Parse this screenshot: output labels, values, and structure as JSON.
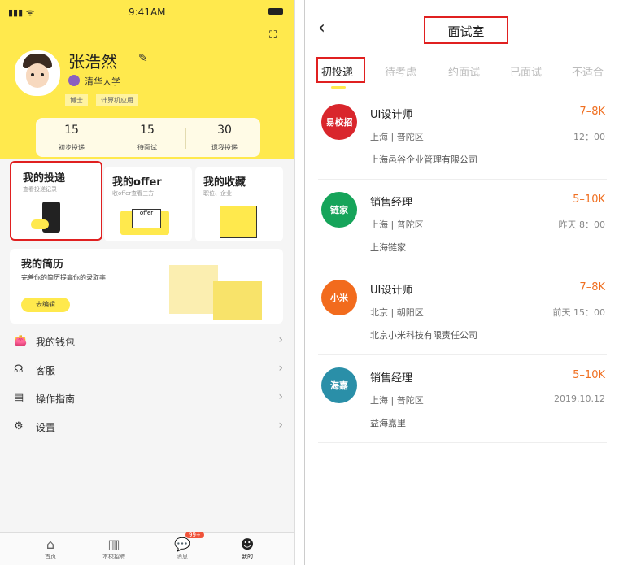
{
  "left": {
    "status": {
      "signal": "…… ▿",
      "time": "9:41AM"
    },
    "profile": {
      "name": "张浩然",
      "school": "清华大学",
      "tags": [
        "博士",
        "计算机应用"
      ]
    },
    "stats": [
      {
        "num": "15",
        "label": "初步投递"
      },
      {
        "num": "15",
        "label": "待面试"
      },
      {
        "num": "30",
        "label": "遗我投递"
      }
    ],
    "cards": [
      {
        "title": "我的投递",
        "sub": "查看投递记录"
      },
      {
        "title": "我的offer",
        "sub": "收offer查看三方"
      },
      {
        "title": "我的收藏",
        "sub": "职位、企业"
      }
    ],
    "resume": {
      "title": "我的简历",
      "sub": "完善你的简历提高你的录取率!",
      "button": "去编辑"
    },
    "menu": [
      {
        "label": "我的钱包"
      },
      {
        "label": "客服"
      },
      {
        "label": "操作指南"
      },
      {
        "label": "设置"
      }
    ],
    "tabbar": [
      {
        "label": "首页"
      },
      {
        "label": "本校招聘"
      },
      {
        "label": "消息",
        "badge": "99+"
      },
      {
        "label": "我的"
      }
    ]
  },
  "right": {
    "title": "面试室",
    "tabs": [
      "初投递",
      "待考虑",
      "约面试",
      "已面试",
      "不适合"
    ],
    "jobs": [
      {
        "title": "UI设计师",
        "salary": "7–8K",
        "location": "上海 | 普陀区",
        "time": "12：00",
        "company": "上海邑谷企业管理有限公司",
        "logo_text": "易校招",
        "logo_color": "#d9262c"
      },
      {
        "title": "销售经理",
        "salary": "5–10K",
        "location": "上海 | 普陀区",
        "time": "昨天 8：00",
        "company": "上海链家",
        "logo_text": "链家",
        "logo_color": "#16a45a"
      },
      {
        "title": "UI设计师",
        "salary": "7–8K",
        "location": "北京 | 朝阳区",
        "time": "前天 15：00",
        "company": "北京小米科技有限责任公司",
        "logo_text": "小米",
        "logo_color": "#f26b1d"
      },
      {
        "title": "销售经理",
        "salary": "5–10K",
        "location": "上海 | 普陀区",
        "time": "2019.10.12",
        "company": "益海嘉里",
        "logo_text": "海嘉",
        "logo_color": "#2a8fa8"
      }
    ]
  }
}
